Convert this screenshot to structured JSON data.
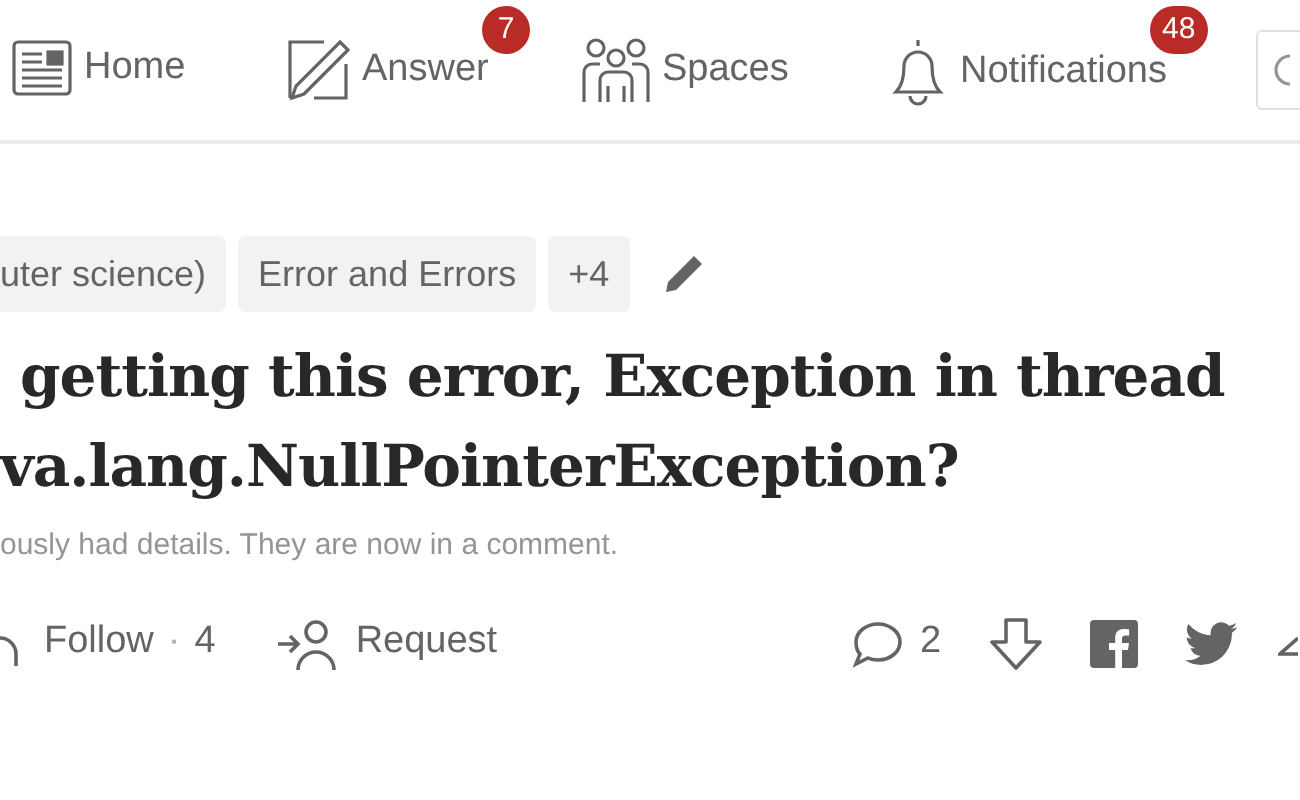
{
  "nav": [
    {
      "kind": "home",
      "label": "Home"
    },
    {
      "kind": "answer",
      "label": "Answer",
      "badge": "7"
    },
    {
      "kind": "spaces",
      "label": "Spaces"
    },
    {
      "kind": "notifications",
      "label": "Notifications",
      "badge": "48"
    }
  ],
  "topics": [
    "uter science)",
    "Error and Errors",
    "+4"
  ],
  "title": [
    "getting this error, Exception in thread",
    "va.lang.NullPointerException?"
  ],
  "note": "ously had details. They are now in a comment.",
  "actions": {
    "follow": "Follow",
    "follow_separator": "·",
    "follow_count": "4",
    "request": "Request",
    "comments": "2"
  }
}
